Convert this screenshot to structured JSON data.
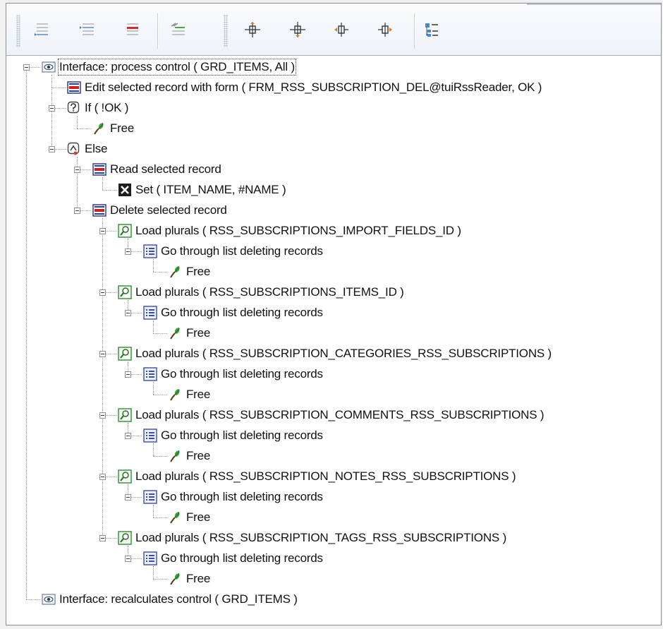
{
  "toolbar": {
    "buttons": [
      {
        "icon": "indent-list-icon"
      },
      {
        "icon": "insert-line-icon"
      },
      {
        "icon": "delete-line-icon"
      },
      {
        "icon": "comment-line-icon"
      },
      {
        "icon": "move-up-icon"
      },
      {
        "icon": "move-down-icon"
      },
      {
        "icon": "move-left-icon"
      },
      {
        "icon": "move-right-icon"
      },
      {
        "icon": "tree-view-icon"
      }
    ]
  },
  "tree": {
    "nodes": [
      {
        "label": "Interface: process control ( GRD_ITEMS, All )",
        "icon": "interface-eye-icon",
        "level": 0
      },
      {
        "label": "Edit selected record with form ( FRM_RSS_SUBSCRIPTION_DEL@tuiRssReader, OK )",
        "icon": "record-form-icon",
        "level": 1
      },
      {
        "label": "If ( !OK )",
        "icon": "if-condition-icon",
        "level": 1
      },
      {
        "label": "Free",
        "icon": "free-leaf-icon",
        "level": 2
      },
      {
        "label": "Else",
        "icon": "else-icon",
        "level": 1
      },
      {
        "label": "Read selected record",
        "icon": "record-icon",
        "level": 2
      },
      {
        "label": "Set ( ITEM_NAME, #NAME )",
        "icon": "set-variable-icon",
        "level": 3
      },
      {
        "label": "Delete selected record",
        "icon": "record-icon",
        "level": 2
      },
      {
        "label": "Load plurals ( RSS_SUBSCRIPTIONS_IMPORT_FIELDS_ID )",
        "icon": "load-plurals-icon",
        "level": 3
      },
      {
        "label": "Go through list deleting records",
        "icon": "list-icon",
        "level": 4
      },
      {
        "label": "Free",
        "icon": "free-leaf-icon",
        "level": 5
      },
      {
        "label": "Load plurals ( RSS_SUBSCRIPTIONS_ITEMS_ID )",
        "icon": "load-plurals-icon",
        "level": 3
      },
      {
        "label": "Go through list deleting records",
        "icon": "list-icon",
        "level": 4
      },
      {
        "label": "Free",
        "icon": "free-leaf-icon",
        "level": 5
      },
      {
        "label": "Load plurals ( RSS_SUBSCRIPTION_CATEGORIES_RSS_SUBSCRIPTIONS )",
        "icon": "load-plurals-icon",
        "level": 3
      },
      {
        "label": "Go through list deleting records",
        "icon": "list-icon",
        "level": 4
      },
      {
        "label": "Free",
        "icon": "free-leaf-icon",
        "level": 5
      },
      {
        "label": "Load plurals ( RSS_SUBSCRIPTION_COMMENTS_RSS_SUBSCRIPTIONS )",
        "icon": "load-plurals-icon",
        "level": 3
      },
      {
        "label": "Go through list deleting records",
        "icon": "list-icon",
        "level": 4
      },
      {
        "label": "Free",
        "icon": "free-leaf-icon",
        "level": 5
      },
      {
        "label": "Load plurals ( RSS_SUBSCRIPTION_NOTES_RSS_SUBSCRIPTIONS )",
        "icon": "load-plurals-icon",
        "level": 3
      },
      {
        "label": "Go through list deleting records",
        "icon": "list-icon",
        "level": 4
      },
      {
        "label": "Free",
        "icon": "free-leaf-icon",
        "level": 5
      },
      {
        "label": "Load plurals ( RSS_SUBSCRIPTION_TAGS_RSS_SUBSCRIPTIONS )",
        "icon": "load-plurals-icon",
        "level": 3
      },
      {
        "label": "Go through list deleting records",
        "icon": "list-icon",
        "level": 4
      },
      {
        "label": "Free",
        "icon": "free-leaf-icon",
        "level": 5
      },
      {
        "label": "Interface: recalculates control ( GRD_ITEMS )",
        "icon": "interface-eye-icon",
        "level": 0
      }
    ]
  }
}
